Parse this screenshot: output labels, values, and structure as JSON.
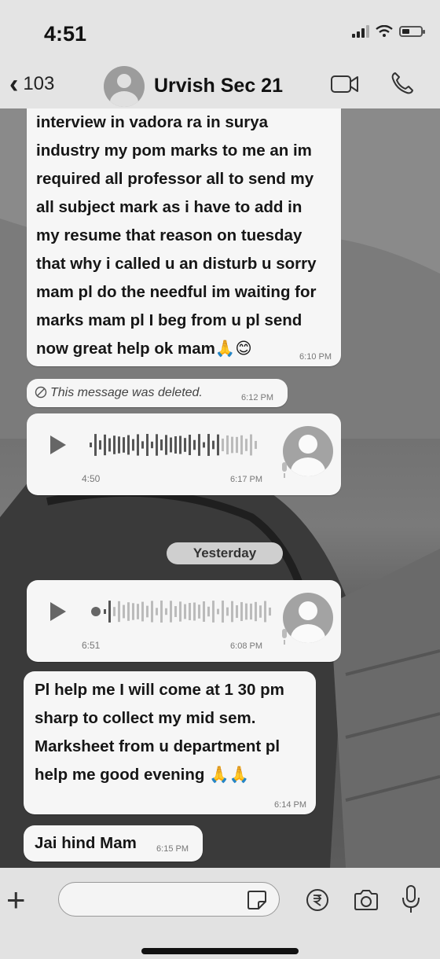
{
  "status_bar": {
    "time": "4:51"
  },
  "header": {
    "back_count": "103",
    "contact_name": "Urvish Sec 21"
  },
  "messages": [
    {
      "text": "interview  in vadora ra in surya\nindustry my pom marks to me an im\nrequired  all professor all to send my\nall subject  mark as i have to add in\nmy resume that reason on tuesday\nthat why i called u an disturb  u sorry\nmam  pl do the needful im waiting for\nmarks mam pl I beg from u pl send\nnow great help ok mam🙏😊",
      "time": "6:10 PM"
    },
    {
      "deleted_text": "This message was deleted.",
      "time": "6:12 PM"
    },
    {
      "voice_duration": "4:50",
      "time": "6:17 PM"
    },
    {
      "date_divider": "Yesterday"
    },
    {
      "voice_duration": "6:51",
      "time": "6:08 PM"
    },
    {
      "text": "Pl help me I will come at 1 30 pm\nsharp to collect my mid sem.\nMarksheet  from u department  pl\nhelp me good evening 🙏🙏",
      "time": "6:14 PM"
    },
    {
      "text": "Jai hind Mam",
      "time": "6:15 PM"
    }
  ],
  "input": {
    "placeholder": ""
  },
  "colors": {
    "bubble": "#f6f6f6",
    "bar": "#e4e4e4"
  }
}
